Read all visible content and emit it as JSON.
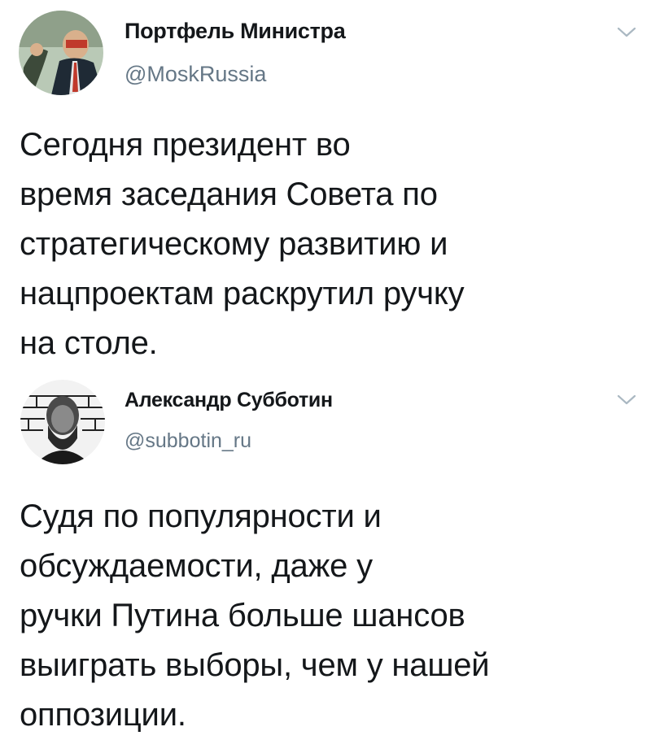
{
  "tweets": [
    {
      "author_name": "Портфель Министра",
      "author_handle": "@MoskRussia",
      "lines": [
        "Сегодня президент во",
        "время заседания Совета по",
        "стратегическому развитию и",
        "нацпроектам раскрутил ручку",
        "на столе."
      ]
    },
    {
      "author_name": "Александр Субботин",
      "author_handle": "@subbotin_ru",
      "lines": [
        "Судя по популярности и",
        "обсуждаемости, даже у",
        "ручки Путина больше шансов",
        "выиграть выборы, чем у нашей",
        "оппозиции."
      ]
    }
  ],
  "icons": {
    "menu": "chevron-down-icon"
  },
  "colors": {
    "text": "#14171a",
    "secondary": "#657786",
    "chevron": "#aab8c2"
  }
}
